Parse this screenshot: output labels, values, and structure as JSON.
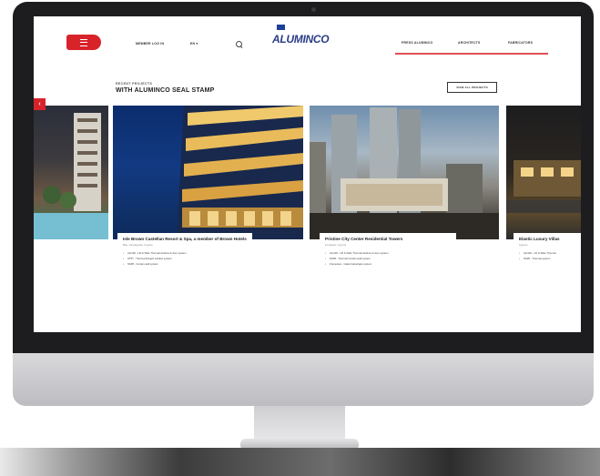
{
  "header": {
    "menu_icon": "hamburger-icon",
    "links": [
      "MEMBER LOG IN",
      "EN ▾"
    ],
    "search_icon": "search-icon",
    "logo": "ALUMINCO",
    "nav": [
      "PRESS ALUMINCO",
      "ARCHITECTS",
      "FABRICATORS"
    ]
  },
  "section": {
    "eyebrow": "RECENT PROJECTS",
    "title": "WITH ALUMINCO SEAL STAMP",
    "view_all": "VIEW ALL PROJECTS"
  },
  "projects": [
    {
      "title": "Isle Brown Castellan Resort & Spa, a member of Brown Hotels",
      "subtitle": "Bay, Famagusta, Cyprus",
      "points": [
        "ALI100 - Lift & Slide Thermal window & door system",
        "ST57 - Thermal Hinged window system",
        "NS95 - Curtain wall system"
      ]
    },
    {
      "title": "Pristine City Center Residential Towers",
      "subtitle": "Limassol, Cyprus",
      "points": [
        "ALI100 - Lift & Slide Thermal window & door system",
        "NS95 - Thermal Curtain wall system",
        "Frameless - Glass balustrade system"
      ]
    },
    {
      "title": "Elastic Luxury Villas",
      "subtitle": "Cyprus",
      "points": [
        "ALI100 - Lift & Slide Thermal",
        "NS95 - Thermal system"
      ]
    }
  ],
  "colors": {
    "accent": "#d8232a",
    "brand": "#2b3d86"
  }
}
